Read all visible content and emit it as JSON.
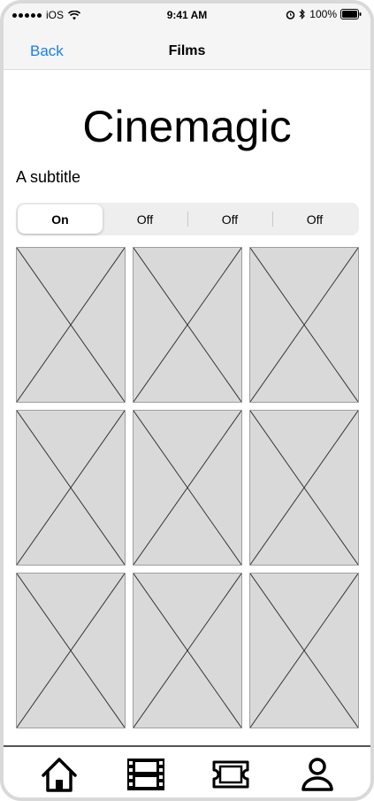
{
  "status": {
    "carrier": "iOS",
    "time": "9:41 AM",
    "battery": "100%"
  },
  "nav": {
    "back_label": "Back",
    "title": "Films"
  },
  "page": {
    "title": "Cinemagic",
    "subtitle": "A subtitle"
  },
  "segments": [
    {
      "label": "On",
      "selected": true
    },
    {
      "label": "Off",
      "selected": false
    },
    {
      "label": "Off",
      "selected": false
    },
    {
      "label": "Off",
      "selected": false
    }
  ],
  "grid": {
    "tile_count": 9,
    "tile_icon": "image-placeholder-icon"
  },
  "tabs": [
    {
      "icon": "home-icon"
    },
    {
      "icon": "film-strip-icon"
    },
    {
      "icon": "ticket-icon"
    },
    {
      "icon": "user-icon"
    }
  ],
  "colors": {
    "accent": "#1a7fe0",
    "bar_background": "#f5f5f5",
    "tile_fill": "#d9d9d9"
  }
}
